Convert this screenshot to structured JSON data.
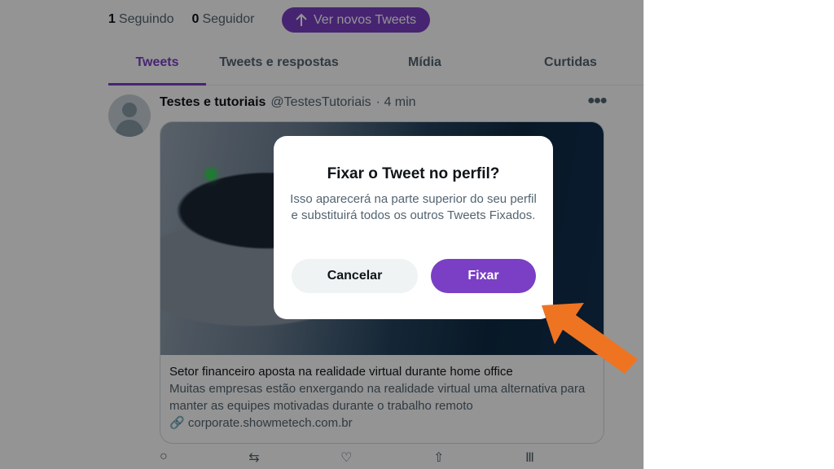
{
  "profile": {
    "following_count": "1",
    "following_label": "Seguindo",
    "followers_count": "0",
    "followers_label": "Seguidor"
  },
  "new_tweets_button": {
    "icon": "arrow-up-icon",
    "label": "Ver novos Tweets"
  },
  "tabs": [
    {
      "label": "Tweets",
      "active": true
    },
    {
      "label": "Tweets e respostas"
    },
    {
      "label": "Mídia"
    },
    {
      "label": "Curtidas"
    }
  ],
  "tweet": {
    "author": "Testes e tutoriais",
    "handle": "@TestesTutoriais",
    "time": "· 4 min",
    "card": {
      "title": "Setor financeiro aposta na realidade virtual durante home office",
      "description": "Muitas empresas estão enxergando na realidade virtual uma alternativa para manter as equipes motivadas durante o trabalho remoto",
      "link": "corporate.showmetech.com.br"
    }
  },
  "modal": {
    "title": "Fixar o Tweet no perfil?",
    "body": "Isso aparecerá na parte superior do seu perfil e substituirá todos os outros Tweets Fixados.",
    "cancel_label": "Cancelar",
    "confirm_label": "Fixar"
  },
  "colors": {
    "accent": "#7a3fc4",
    "arrow": "#ee7422",
    "overlay": "rgba(0,0,0,0.42)"
  }
}
